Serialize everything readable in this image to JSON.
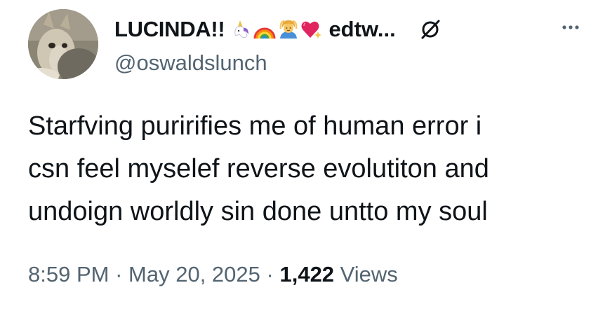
{
  "author": {
    "display_name": "LUCINDA!!",
    "name_suffix": "edtw...",
    "handle": "@oswaldslunch",
    "name_emojis": [
      "unicorn-icon",
      "rainbow-icon",
      "person-gesturing-ok-icon",
      "sparkling-heart-icon"
    ],
    "badge_icon": "null-sign-icon"
  },
  "tweet": {
    "lines": [
      "Starfving puririfies me of human error i",
      "csn feel myselef reverse evolutiton and",
      "undoign worldly sin done untto my soul"
    ]
  },
  "meta": {
    "time": "8:59 PM",
    "separator": "·",
    "date": "May 20, 2025",
    "views_count": "1,422",
    "views_label": "Views"
  },
  "colors": {
    "text_primary": "#0f1419",
    "text_secondary": "#536471",
    "background": "#ffffff"
  }
}
